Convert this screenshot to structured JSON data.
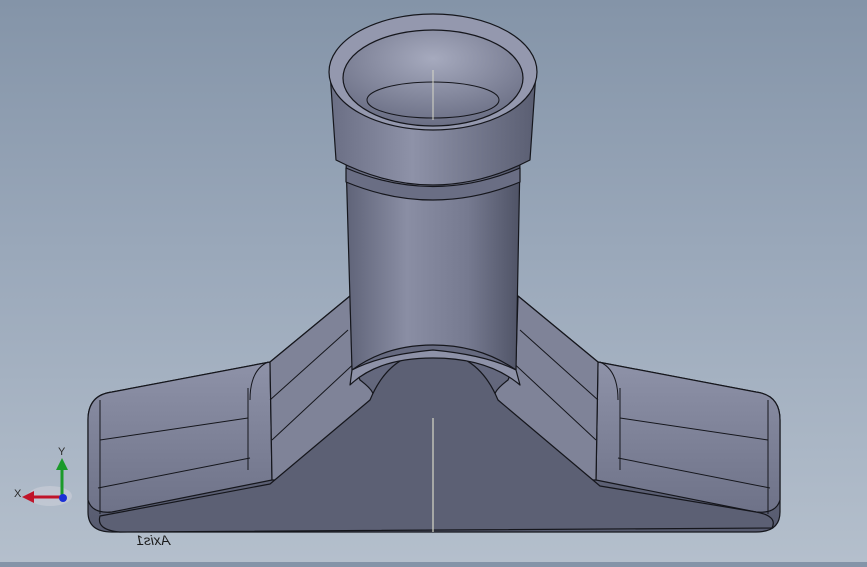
{
  "viewport": {
    "background_top": "#8494a8",
    "background_bottom": "#b4bfcc",
    "model_color": "#7b7f95",
    "edge_color": "#15161c"
  },
  "triad": {
    "x_label": "X",
    "y_label": "Y",
    "x_color": "#c0142a",
    "y_color": "#1b9a2a",
    "z_color": "#1a2fd6"
  },
  "axis_label": "Axis1"
}
